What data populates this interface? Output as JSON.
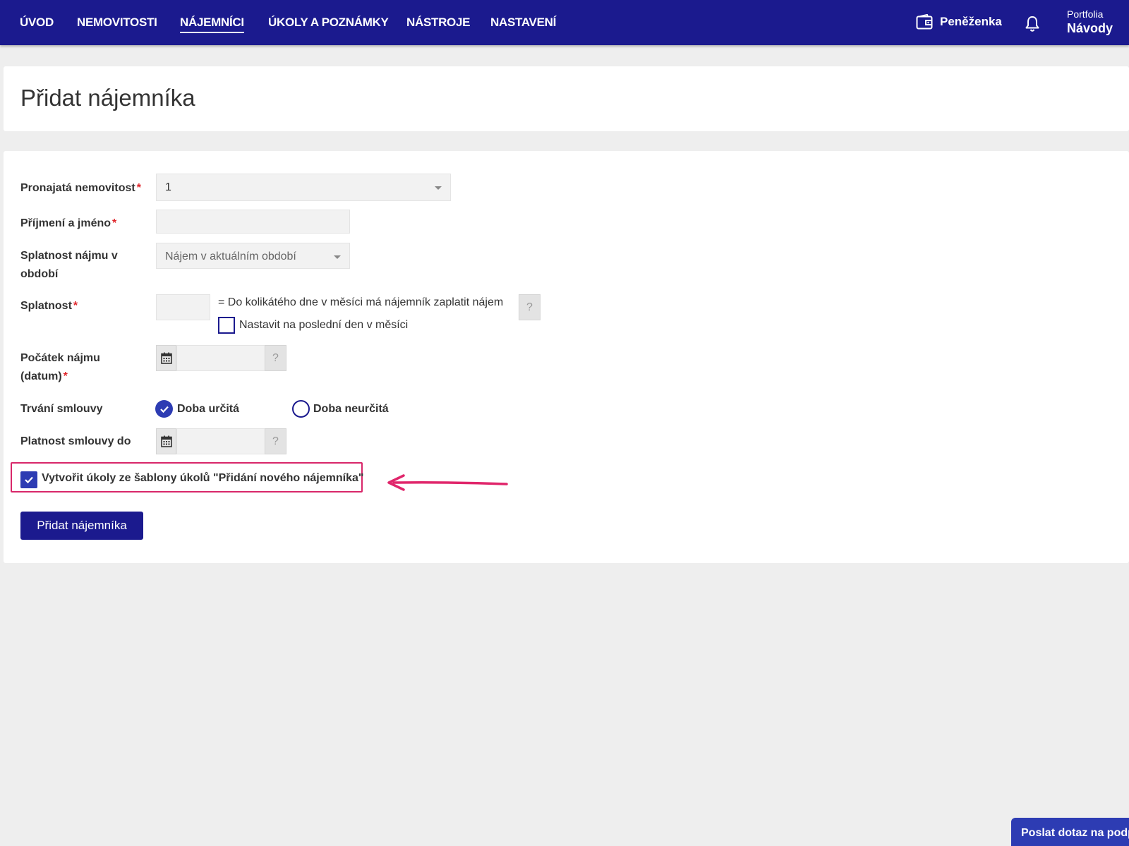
{
  "nav": {
    "items": [
      {
        "label": "ÚVOD",
        "active": false
      },
      {
        "label": "NEMOVITOSTI",
        "active": false
      },
      {
        "label": "NÁJEMNÍCI",
        "active": true
      },
      {
        "label": "ÚKOLY A POZNÁMKY",
        "active": false
      },
      {
        "label": "NÁSTROJE",
        "active": false
      },
      {
        "label": "NASTAVENÍ",
        "active": false
      }
    ],
    "wallet_label": "Peněženka",
    "portfolio_small": "Portfolia",
    "portfolio_name": "Návody"
  },
  "page": {
    "title": "Přidat nájemníka"
  },
  "form": {
    "property_label": "Pronajatá nemovitost",
    "property_value": "1",
    "name_label": "Příjmení a jméno",
    "name_value": "",
    "due_period_label_1": "Splatnost nájmu v",
    "due_period_label_2": "období",
    "due_period_value": "Nájem v aktuálním období",
    "due_label": "Splatnost",
    "due_value": "",
    "due_hint": "= Do kolikátého dne v měsíci má nájemník zaplatit nájem",
    "help_mark": "?",
    "last_day_label": "Nastavit na poslední den v měsíci",
    "last_day_checked": false,
    "start_label_1": "Počátek nájmu",
    "start_label_2": "(datum)",
    "start_value": "",
    "duration_label": "Trvání smlouvy",
    "duration_fixed": "Doba určitá",
    "duration_indefinite": "Doba neurčitá",
    "duration_selected": "Doba určitá",
    "valid_until_label": "Platnost smlouvy do",
    "valid_until_value": "",
    "required_mark": "*",
    "create_tasks_label": "Vytvořit úkoly ze šablony úkolů \"Přidání nového nájemníka\"",
    "create_tasks_checked": true,
    "submit_label": "Přidat nájemníka"
  },
  "support": {
    "label": "Poslat dotaz na podporu"
  },
  "colors": {
    "navbar": "#1b1a8e",
    "accent": "#2d3cb3",
    "required": "#e0262b",
    "highlight": "#d8276a"
  }
}
